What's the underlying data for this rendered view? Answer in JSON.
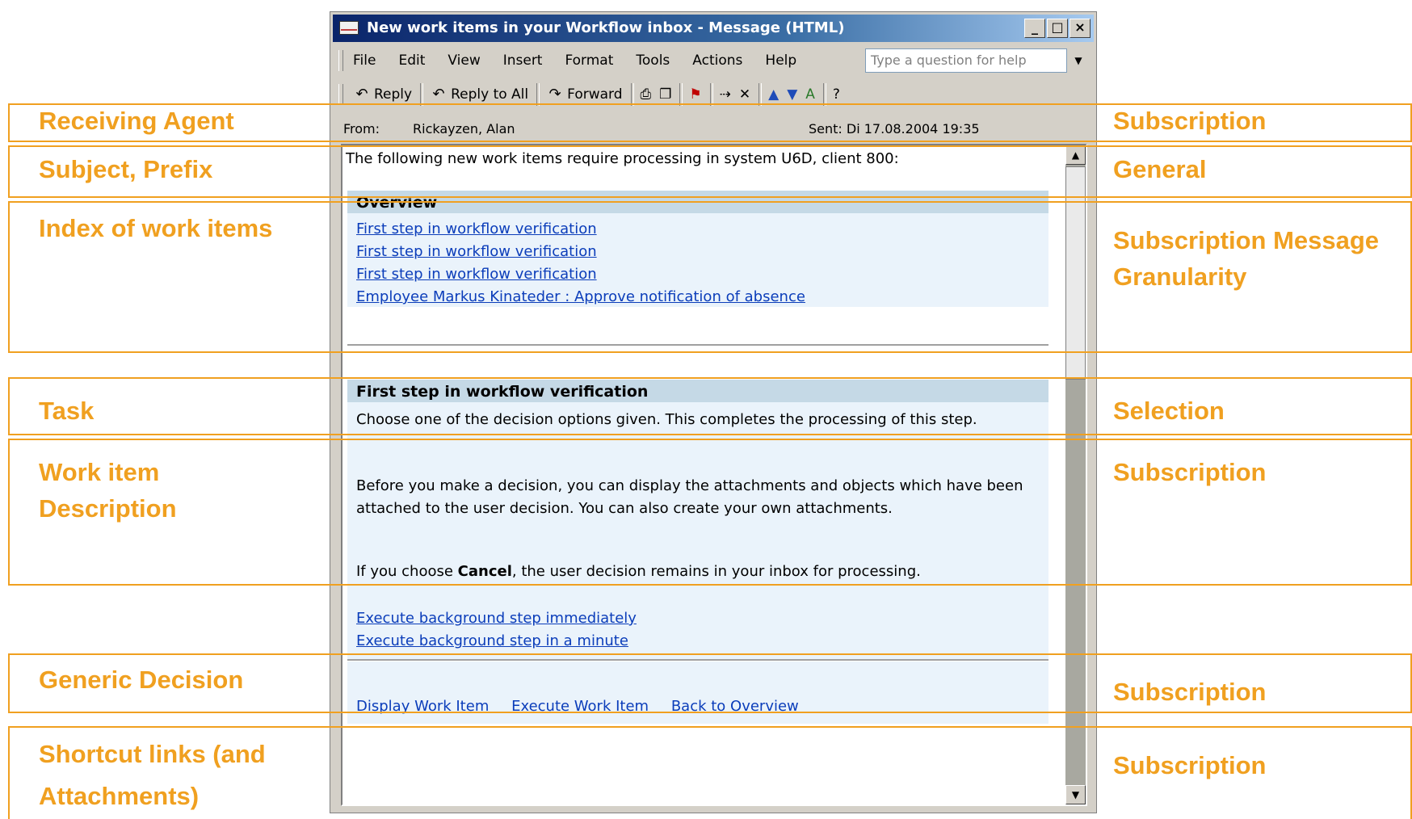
{
  "window": {
    "title": "New work items in your Workflow inbox - Message (HTML)",
    "controls": [
      "_",
      "□",
      "×"
    ]
  },
  "menu": {
    "items": [
      "File",
      "Edit",
      "View",
      "Insert",
      "Format",
      "Tools",
      "Actions",
      "Help"
    ],
    "help_placeholder": "Type a question for help"
  },
  "toolbar": {
    "reply": "Reply",
    "reply_all": "Reply to All",
    "forward": "Forward"
  },
  "header": {
    "from_label": "From:",
    "from_value": "Rickayzen, Alan",
    "sent": "Sent:  Di 17.08.2004 19:35"
  },
  "message": {
    "intro": "The following new work items require processing in system U6D, client 800:",
    "overview_title": "Overview",
    "overview_links": [
      "First step in workflow verification",
      "First step in workflow verification",
      "First step in workflow verification",
      "Employee Markus Kinateder : Approve notification of absence"
    ],
    "task_title": "First step in workflow verification",
    "desc_1": "Choose one of the decision options given. This completes the processing of this step.",
    "desc_2": "Before you make a decision, you can display the attachments and objects which have been attached to the user decision. You can also create your own attachments.",
    "desc_3_pre": "If you choose ",
    "desc_3_bold": "Cancel",
    "desc_3_post": ", the user decision remains in your inbox for processing.",
    "decisions": [
      "Execute background step immediately",
      "Execute background step in a minute"
    ],
    "shortcuts": [
      "Display Work Item",
      "Execute Work Item",
      "Back to Overview"
    ]
  },
  "annotations": {
    "left": [
      "Receiving Agent",
      "Subject, Prefix",
      "Index of work items",
      "Task",
      "Work item Description",
      "Generic Decision",
      "Shortcut links (and Attachments)"
    ],
    "right": [
      "Subscription",
      "General",
      "Subscription Message Granularity",
      "Selection",
      "Subscription",
      "Subscription",
      "Subscription"
    ],
    "color": "#f0a020"
  },
  "colors": {
    "title_gradient_start": "#0a246a",
    "link": "#0b3dba",
    "panel_header": "#c5d9e6",
    "panel_bg": "#eaf3fb"
  }
}
